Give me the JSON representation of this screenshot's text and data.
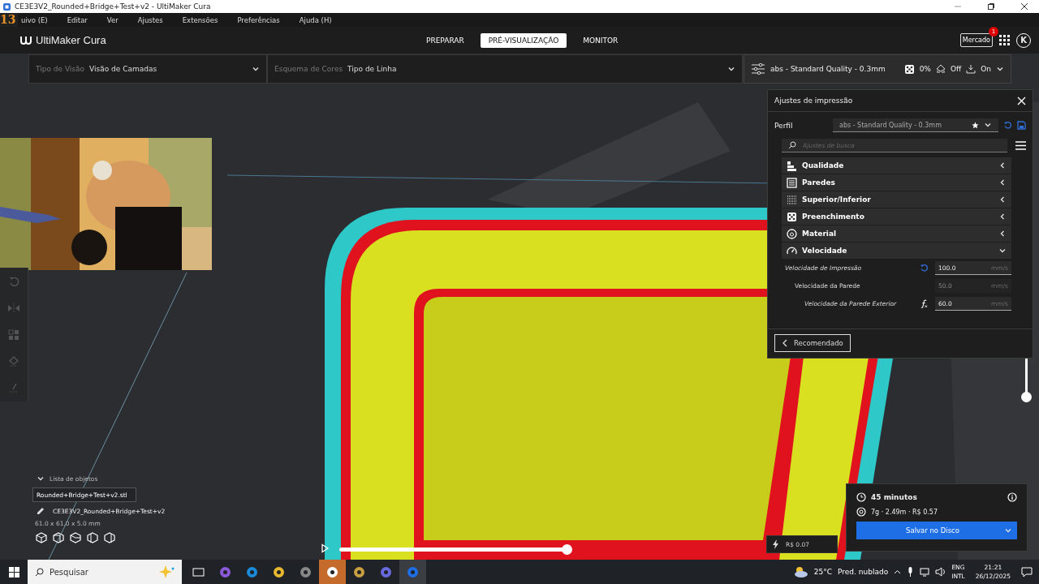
{
  "window": {
    "title": "CE3E3V2_Rounded+Bridge+Test+v2 - UltiMaker Cura"
  },
  "overlay_badge": "13",
  "menu": [
    "uivo (E)",
    "Editar",
    "Ver",
    "Ajustes",
    "Extensões",
    "Preferências",
    "Ajuda (H)"
  ],
  "header": {
    "logo": "UltiMaker Cura",
    "stages": [
      {
        "label": "PREPARAR",
        "selected": false
      },
      {
        "label": "PRÉ-VISUALIZAÇÃO",
        "selected": true
      },
      {
        "label": "MONITOR",
        "selected": false
      }
    ],
    "marketplace": {
      "label": "Mercado",
      "badge": "1"
    },
    "avatar": "K"
  },
  "view_bar": {
    "view_type": {
      "label": "Tipo de Visão",
      "value": "Visão de Camadas"
    },
    "color_scheme": {
      "label": "Esquema de Cores",
      "value": "Tipo de Linha"
    }
  },
  "print_setup": {
    "profile": "abs - Standard Quality - 0.3mm",
    "infill": "0%",
    "support": "Off",
    "adhesion": "On"
  },
  "settings_panel": {
    "title": "Ajustes de impressão",
    "profile_label": "Perfil",
    "profile": "abs - Standard Quality - 0.3mm",
    "search": {
      "placeholder": "Ajustes de busca"
    },
    "categories": [
      {
        "label": "Qualidade",
        "kind": "quality",
        "expanded": false
      },
      {
        "label": "Paredes",
        "kind": "walls",
        "expanded": false
      },
      {
        "label": "Superior/Inferior",
        "kind": "topbottom",
        "expanded": false
      },
      {
        "label": "Preenchimento",
        "kind": "infill",
        "expanded": false
      },
      {
        "label": "Material",
        "kind": "material",
        "expanded": false
      },
      {
        "label": "Velocidade",
        "kind": "speed",
        "expanded": true
      }
    ],
    "settings": [
      {
        "label": "Velocidade de Impressão",
        "value": "100.0",
        "unit": "mm/s",
        "kind": "reset",
        "modified": true,
        "disabled": false,
        "children": [
          {
            "label": "Velocidade da Parede",
            "value": "50.0",
            "unit": "mm/s",
            "modified": false,
            "disabled": true,
            "children": [
              {
                "label": "Velocidade da Parede Exterior",
                "value": "60.0",
                "unit": "mm/s",
                "kind": "formula",
                "modified": true,
                "disabled": false
              }
            ]
          }
        ]
      }
    ],
    "recommended_button": "Recomendado"
  },
  "object_list": {
    "title": "Lista de objetos",
    "expanded": true,
    "file": "Rounded+Bridge+Test+v2.stl",
    "job_name": "CE3E3V2_Rounded+Bridge+Test+v2",
    "dimensions": "61.0 x 61.0 x 5.0 mm"
  },
  "layer_slider": {
    "level": 1
  },
  "layer_range_slider": {
    "level": 1
  },
  "cost": "R$ 0.07",
  "summary": {
    "time": "45 minutos",
    "material": "7g · 2.49m · R$ 0.57",
    "save_button": "Salvar no Disco"
  },
  "taskbar": {
    "search": {
      "placeholder": "Pesquisar"
    },
    "temperature": "25°C",
    "weather": "Pred. nublado",
    "language": "ENG",
    "layout": "INTL",
    "time": "21:21",
    "date": "26/12/2025"
  }
}
